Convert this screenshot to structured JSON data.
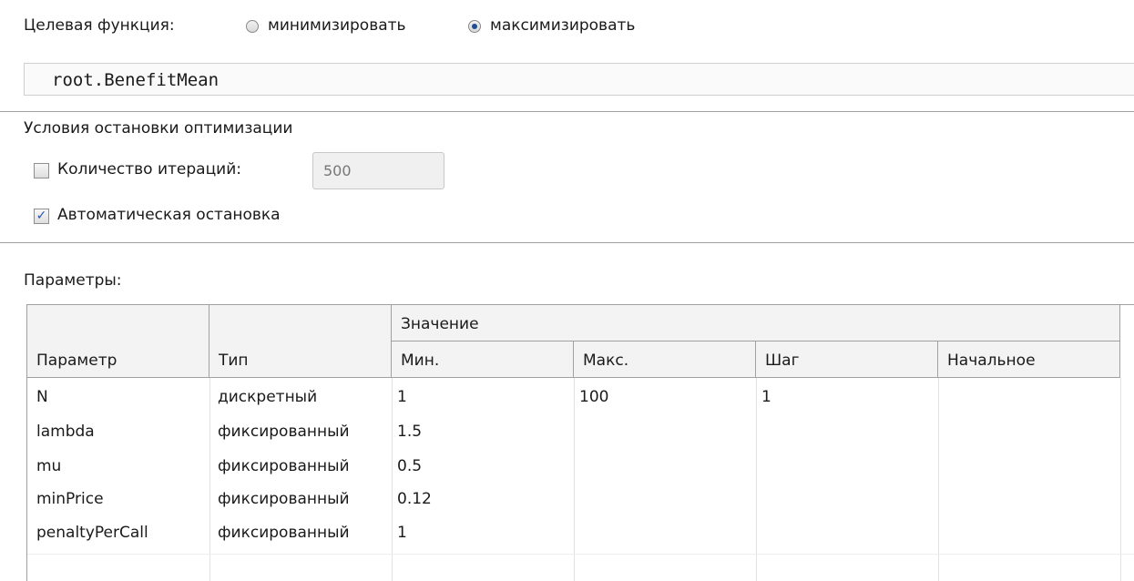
{
  "objective": {
    "label": "Целевая функция:",
    "options": [
      {
        "label": "минимизировать",
        "selected": false
      },
      {
        "label": "максимизировать",
        "selected": true
      }
    ],
    "expression": "root.BenefitMean"
  },
  "stop_conditions": {
    "title": "Условия остановки оптимизации",
    "iterations": {
      "label": "Количество итераций:",
      "checked": false,
      "value": "500"
    },
    "auto_stop": {
      "label": "Автоматическая остановка",
      "checked": true
    }
  },
  "parameters": {
    "title": "Параметры:",
    "headers": {
      "param": "Параметр",
      "type": "Тип",
      "value_group": "Значение",
      "min": "Мин.",
      "max": "Макс.",
      "step": "Шаг",
      "initial": "Начальное"
    },
    "rows": [
      {
        "param": "N",
        "type": "дискретный",
        "min": "1",
        "max": "100",
        "step": "1",
        "initial": ""
      },
      {
        "param": "lambda",
        "type": "фиксированный",
        "min": "1.5",
        "max": "",
        "step": "",
        "initial": ""
      },
      {
        "param": "mu",
        "type": "фиксированный",
        "min": "0.5",
        "max": "",
        "step": "",
        "initial": ""
      },
      {
        "param": "minPrice",
        "type": "фиксированный",
        "min": "0.12",
        "max": "",
        "step": "",
        "initial": ""
      },
      {
        "param": "penaltyPerCall",
        "type": "фиксированный",
        "min": "1",
        "max": "",
        "step": "",
        "initial": ""
      }
    ]
  },
  "colors": {
    "accent": "#1f4f8f",
    "check": "#2a55a8",
    "grid": "#a0a0a0"
  }
}
